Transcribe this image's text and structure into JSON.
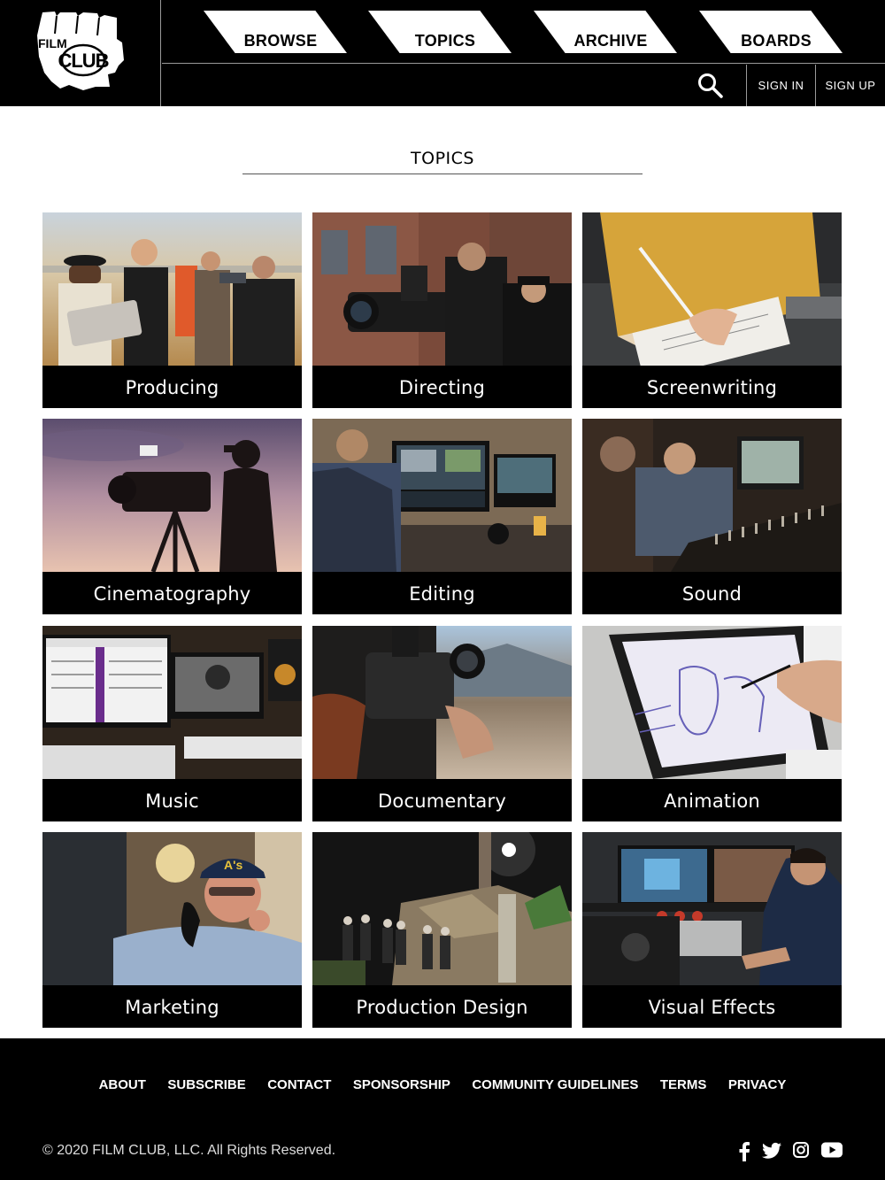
{
  "brand": {
    "logo_line1": "FILM",
    "logo_line2": "CLUB"
  },
  "nav": {
    "tabs": [
      {
        "label": "BROWSE"
      },
      {
        "label": "TOPICS"
      },
      {
        "label": "ARCHIVE"
      },
      {
        "label": "BOARDS"
      }
    ],
    "search_icon": "search-icon",
    "sign_in": "SIGN IN",
    "sign_up": "SIGN UP"
  },
  "page": {
    "title": "TOPICS"
  },
  "topics": [
    {
      "label": "Producing"
    },
    {
      "label": "Directing"
    },
    {
      "label": "Screenwriting"
    },
    {
      "label": "Cinematography"
    },
    {
      "label": "Editing"
    },
    {
      "label": "Sound"
    },
    {
      "label": "Music"
    },
    {
      "label": "Documentary"
    },
    {
      "label": "Animation"
    },
    {
      "label": "Marketing"
    },
    {
      "label": "Production Design"
    },
    {
      "label": "Visual Effects"
    }
  ],
  "footer": {
    "links": [
      "ABOUT",
      "SUBSCRIBE",
      "CONTACT",
      "SPONSORSHIP",
      "COMMUNITY GUIDELINES",
      "TERMS",
      "PRIVACY"
    ],
    "copyright": "© 2020 FILM CLUB, LLC. All Rights Reserved.",
    "social_icons": [
      "facebook-icon",
      "twitter-icon",
      "instagram-icon",
      "youtube-icon"
    ]
  },
  "colors": {
    "header_bg": "#000000",
    "tab_bg": "#ffffff",
    "caption_bg": "#000000",
    "footer_bg": "#000000"
  }
}
